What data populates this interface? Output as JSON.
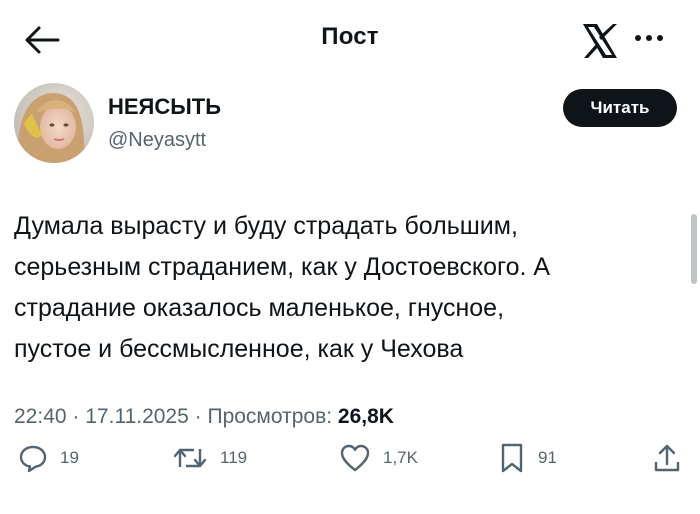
{
  "header": {
    "title": "Пост",
    "back_icon": "arrow-left-icon",
    "logo_icon": "x-logo-icon",
    "more_icon": "more-dots-icon"
  },
  "author": {
    "name": "НЕЯСЫТЬ",
    "handle": "@Neyasytt",
    "read_button": "Читать"
  },
  "post": {
    "text": "Думала вырасту и буду страдать большим,\nсерьезным страданием, как у Достоевского. А\nстрадание оказалось маленькое, гнусное,\nпустое и бессмысленное, как у Чехова"
  },
  "meta": {
    "time": "22:40",
    "separator": "·",
    "date": "17.11.2025",
    "views_label": "Просмотров:",
    "views_count": "26,8K"
  },
  "actions": {
    "replies": "19",
    "reposts": "119",
    "likes": "1,7K",
    "bookmarks": "91"
  },
  "colors": {
    "text": "#0f1419",
    "secondary": "#536471",
    "button_bg": "#0f1419"
  }
}
